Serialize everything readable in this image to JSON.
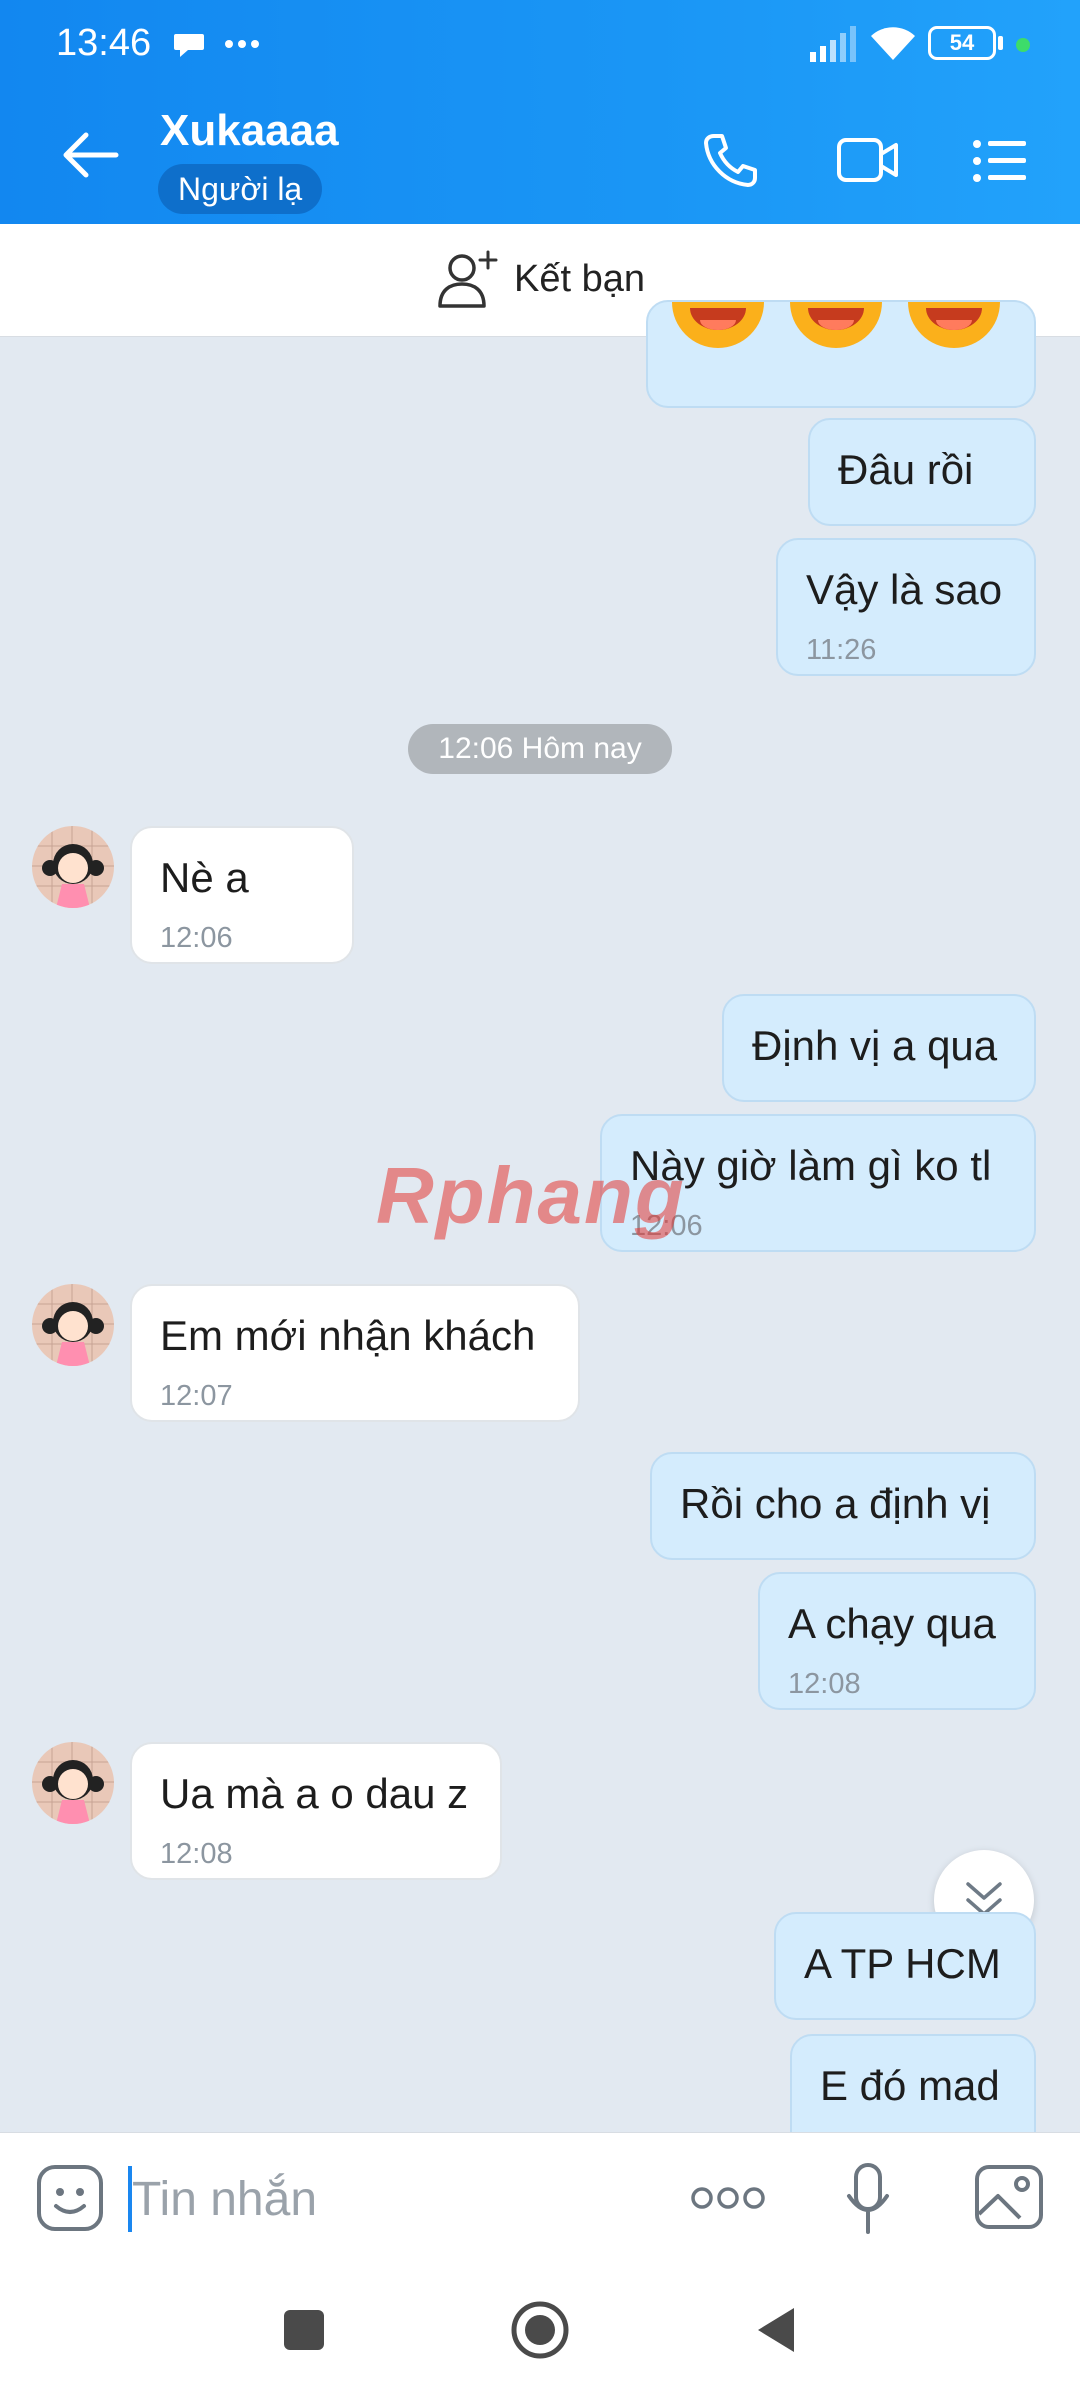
{
  "status_bar": {
    "time": "13:46",
    "battery": "54"
  },
  "header": {
    "contact_name": "Xukaaaa",
    "badge": "Người lạ"
  },
  "add_friend": {
    "label": "Kết bạn"
  },
  "messages": [
    {
      "text": "Đâu rồi"
    },
    {
      "text": "Vậy là sao",
      "time": "11:26"
    },
    {
      "text": "Nè a",
      "time": "12:06"
    },
    {
      "text": "Định vị a qua"
    },
    {
      "text": "Này giờ làm gì ko tl",
      "time": "12:06"
    },
    {
      "text": "Em mới nhận khách",
      "time": "12:07"
    },
    {
      "text": "Rồi cho a định vị"
    },
    {
      "text": "A chạy qua",
      "time": "12:08"
    },
    {
      "text": "Ua mà a o dau z",
      "time": "12:08"
    },
    {
      "text": "A TP HCM"
    },
    {
      "text": "E đó mad"
    }
  ],
  "date_separator": "12:06 Hôm nay",
  "watermark": "Rphang",
  "composer": {
    "placeholder": "Tin nhắn"
  },
  "colors": {
    "header": "#1a96f5",
    "my_bubble": "#d4ecfd",
    "their_bubble": "#ffffff",
    "background": "#e2e9f1"
  }
}
